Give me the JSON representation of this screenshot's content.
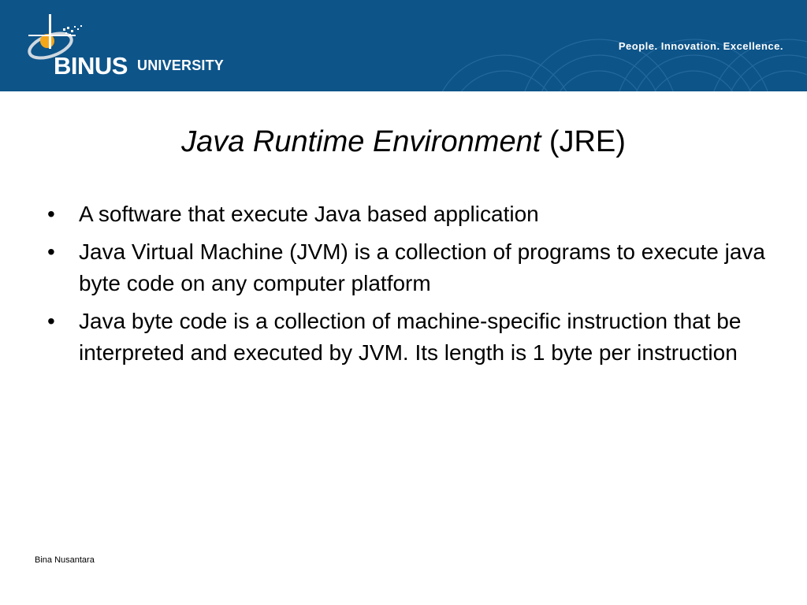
{
  "header": {
    "brand": "BINUS",
    "brand_suffix": "UNIVERSITY",
    "tagline": "People. Innovation. Excellence.",
    "background_color": "#0d5489"
  },
  "slide": {
    "title_italic": "Java Runtime Environment",
    "title_rest": " (JRE)",
    "bullets": [
      "A software that execute Java based application",
      "Java Virtual Machine (JVM) is a collection of programs to execute java byte code on any computer platform",
      "Java byte code is a collection of machine-specific instruction that be interpreted and executed by JVM. Its length is 1 byte per instruction"
    ],
    "bullet_glyph": "•"
  },
  "footer": {
    "text": "Bina Nusantara"
  }
}
